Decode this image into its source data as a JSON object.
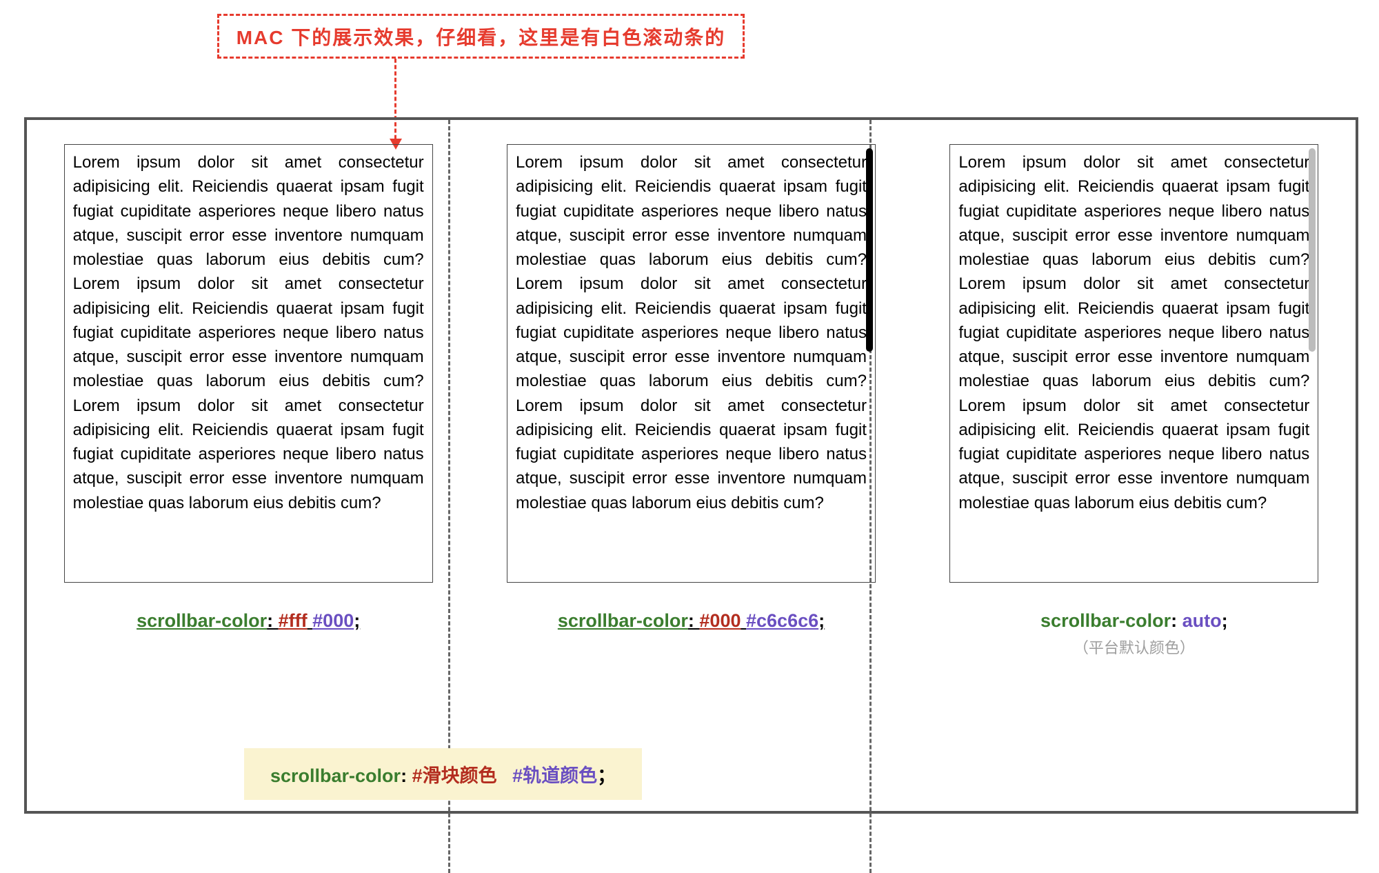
{
  "callout": "MAC 下的展示效果，仔细看，这里是有白色滚动条的",
  "demoText": "Lorem ipsum dolor sit amet consectetur adipisicing elit. Reiciendis quaerat ipsam fugit fugiat cupiditate asperiores neque libero natus atque, suscipit error esse inventore numquam molestiae quas laborum eius debitis cum? Lorem ipsum dolor sit amet consectetur adipisicing elit. Reiciendis quaerat ipsam fugit fugiat cupiditate asperiores neque libero natus atque, suscipit error esse inventore numquam molestiae quas laborum eius debitis cum? Lorem ipsum dolor sit amet consectetur adipisicing elit. Reiciendis quaerat ipsam fugit fugiat cupiditate asperiores neque libero natus atque, suscipit error esse inventore numquam molestiae quas laborum eius debitis cum?",
  "columns": [
    {
      "property": "scrollbar-color",
      "value1": "#fff",
      "value2": "#000",
      "underline": true,
      "scrollbar": "none"
    },
    {
      "property": "scrollbar-color",
      "value1": "#000",
      "value2": "#c6c6c6",
      "underline": true,
      "scrollbar": "black"
    },
    {
      "property": "scrollbar-color",
      "value1": "auto",
      "value2": "",
      "underline": false,
      "scrollbar": "gray",
      "subnote": "（平台默认颜色）"
    }
  ],
  "legend": {
    "property": "scrollbar-color",
    "thumb": "#滑块颜色",
    "track": "#轨道颜色",
    "semicolon": "；"
  }
}
